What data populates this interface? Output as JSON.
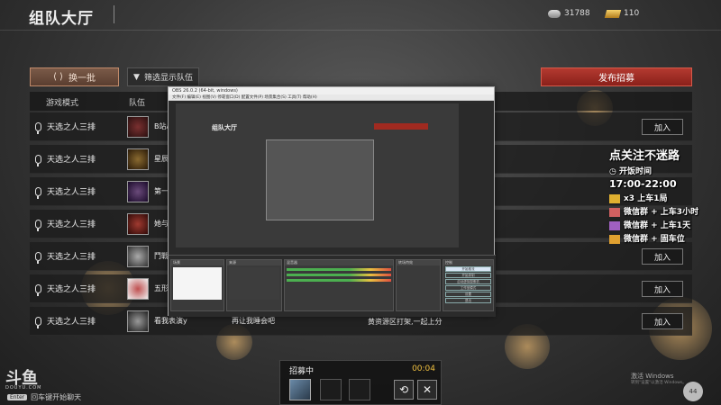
{
  "topbar": {
    "title": "组队大厅",
    "silver_value": "31788",
    "gold_value": "110"
  },
  "toolbar": {
    "switch_label": "换一批",
    "filter_label": "筛选显示队伍",
    "publish_label": "发布招募"
  },
  "table": {
    "headers": [
      "游戏模式",
      "队伍"
    ],
    "rows": [
      {
        "mode": "天选之人三排",
        "team": "B站A",
        "second": "",
        "join": "加入"
      },
      {
        "mode": "天选之人三排",
        "team": "星辰寻",
        "second": "",
        "join": ""
      },
      {
        "mode": "天选之人三排",
        "team": "第一次",
        "second": "",
        "join": ""
      },
      {
        "mode": "天选之人三排",
        "team": "她与猫",
        "second": "",
        "join": ""
      },
      {
        "mode": "天选之人三排",
        "team": "鬥戰",
        "second": "",
        "join": "加入"
      },
      {
        "mode": "天选之人三排",
        "team": "五形",
        "second": "",
        "join": "加入"
      },
      {
        "mode": "天选之人三排",
        "team": "看我表演y",
        "second": "再让我睡会吧",
        "join": "加入"
      }
    ],
    "footer_text": "黄资源区打架,一起上分"
  },
  "obs": {
    "window_title": "OBS 26.0.2 (64-bit, windows)",
    "menu": "文件(F)  编辑(E)  视图(V)  停靠窗口(D)  配置文件(P)  场景集合(S)  工具(T)  帮助(H)",
    "mini_title": "组队大厅",
    "panels": [
      "场景",
      "来源",
      "混音器",
      "转场特效",
      "控制"
    ],
    "controls": [
      "开始推流",
      "开始录制",
      "启动虚拟摄像机",
      "工作室模式",
      "设置",
      "退出"
    ]
  },
  "overlay": {
    "line1": "点关注不迷路",
    "line2": "开饭时间",
    "line3": "17:00-22:00",
    "line4": "x3  上车1局",
    "line5": "微信群 + 上车3小时",
    "line6": "微信群 + 上车1天",
    "line7": "微信群 + 固车位"
  },
  "recruit": {
    "title": "招募中",
    "timer": "00:04"
  },
  "footer": {
    "douyu": "斗鱼",
    "douyu_domain": "DOUYU.COM",
    "enter_key": "Enter",
    "chat_hint": "回车键开始聊天",
    "win_activate": "激活 Windows",
    "win_activate_sub": "转到\"设置\"以激活 Windows。",
    "circle_value": "44"
  }
}
